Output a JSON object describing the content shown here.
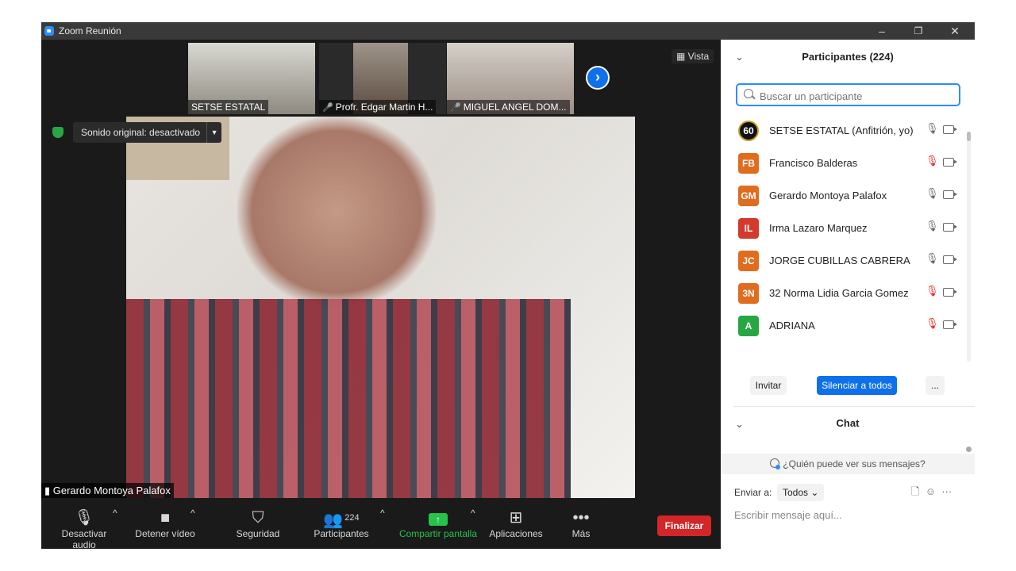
{
  "window": {
    "title": "Zoom Reunión",
    "minimize": "–",
    "restore": "❐",
    "close": "✕"
  },
  "thumbnails": [
    {
      "label": "SETSE ESTATAL",
      "muted": false,
      "color": "#c8c8c0"
    },
    {
      "label": "Profr. Edgar Martin H...",
      "muted": true,
      "color": "#7a6a5a"
    },
    {
      "label": "MIGUEL ANGEL DOM...",
      "muted": true,
      "color": "#b9aea2"
    }
  ],
  "next_arrow": "›",
  "view_button": "Vista",
  "audio_banner": {
    "text": "Sonido original: desactivado",
    "dropdown": "▼"
  },
  "speaker_label": "Gerardo Montoya Palafox",
  "toolbar": {
    "mute": "Desactivar audio",
    "stop_video": "Detener vídeo",
    "security": "Seguridad",
    "participants": "Participantes",
    "participants_count": "224",
    "share": "Compartir pantalla",
    "apps": "Aplicaciones",
    "more": "Más",
    "end": "Finalizar"
  },
  "participants_panel": {
    "title": "Participantes (224)",
    "search_placeholder": "Buscar un participante",
    "participants": [
      {
        "initials": "60",
        "name": "SETSE ESTATAL (Anfitrión, yo)",
        "color": "#111111",
        "muted": false
      },
      {
        "initials": "FB",
        "name": "Francisco Balderas",
        "color": "#e06c1e",
        "muted": true
      },
      {
        "initials": "GM",
        "name": "Gerardo Montoya Palafox",
        "color": "#e06c1e",
        "muted": false
      },
      {
        "initials": "IL",
        "name": "Irma Lazaro Marquez",
        "color": "#d33a2c",
        "muted": false
      },
      {
        "initials": "JC",
        "name": "JORGE CUBILLAS CABRERA",
        "color": "#e06c1e",
        "muted": false
      },
      {
        "initials": "3N",
        "name": "32 Norma Lidia Garcia Gomez",
        "color": "#e06c1e",
        "muted": true
      },
      {
        "initials": "A",
        "name": "ADRIANA",
        "color": "#27a744",
        "muted": true
      }
    ],
    "invite": "Invitar",
    "mute_all": "Silenciar a todos",
    "more": "..."
  },
  "chat": {
    "title": "Chat",
    "who_can_see": "¿Quién puede ver sus mensajes?",
    "send_to_label": "Enviar a:",
    "send_to_value": "Todos",
    "placeholder": "Escribir mensaje aquí..."
  }
}
